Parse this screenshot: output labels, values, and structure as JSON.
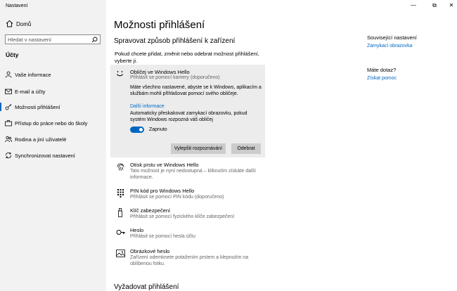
{
  "window": {
    "title": "Nastavení",
    "minimize": "—",
    "maximize": "⧉",
    "close": "✕"
  },
  "sidebar": {
    "home_label": "Domů",
    "search_placeholder": "Hledat v nastavení",
    "section": "Účty",
    "items": [
      {
        "label": "Vaše informace",
        "icon": "person-card-icon"
      },
      {
        "label": "E-mail a účty",
        "icon": "mail-icon"
      },
      {
        "label": "Možnosti přihlášení",
        "icon": "key-icon",
        "active": true
      },
      {
        "label": "Přístup do práce nebo do školy",
        "icon": "briefcase-icon"
      },
      {
        "label": "Rodina a jiní uživatelé",
        "icon": "people-icon"
      },
      {
        "label": "Synchronizovat nastavení",
        "icon": "sync-icon"
      }
    ]
  },
  "main": {
    "title": "Možnosti přihlášení",
    "subtitle": "Spravovat způsob přihlášení k zařízení",
    "intro": "Pokud chcete přidat, změnit nebo odebrat možnost přihlášení, vyberte ji.",
    "hello_face": {
      "title": "Obličej ve Windows Hello",
      "subtitle": "Přihlásit se pomocí kamery (doporučeno)",
      "description": "Máte všechno nastavené, abyste se k Windows, aplikacím a službám mohli přihlašovat pomocí svého obličeje.",
      "more_link": "Další informace",
      "auto_text": "Automaticky přeskakovat zamykací obrazovku, pokud systém Windows rozpozná váš obličej",
      "toggle_label": "Zapnuto",
      "toggle_on": true,
      "improve_button": "Vylepšit rozpoznávání",
      "remove_button": "Odebrat"
    },
    "options": [
      {
        "title": "Otisk prstu ve Windows Hello",
        "subtitle": "Tato možnost je nyní nedostupná – kliknutím získáte další informace.",
        "icon": "fingerprint-icon"
      },
      {
        "title": "PIN kód pro Windows Hello",
        "subtitle": "Přihlásit se pomocí PIN kódu (doporučeno)",
        "icon": "pin-keypad-icon"
      },
      {
        "title": "Klíč zabezpečení",
        "subtitle": "Přihlásit se pomocí fyzického klíče zabezpečení",
        "icon": "usb-key-icon"
      },
      {
        "title": "Heslo",
        "subtitle": "Přihlásit se pomocí hesla účtu",
        "icon": "password-key-icon"
      },
      {
        "title": "Obrázkové heslo",
        "subtitle": "Zařízení odemknete potažením prstem a klepnutím na oblíbenou fotku.",
        "icon": "picture-icon"
      }
    ],
    "require_title": "Vyžadovat přihlášení"
  },
  "right": {
    "related_title": "Související nastavení",
    "related_link": "Zamykací obrazovka",
    "question_title": "Máte dotaz?",
    "help_link": "Získat pomoc"
  },
  "colors": {
    "accent": "#0067c0",
    "sidebar_bg": "#f2f2f2",
    "card_bg": "#ececec"
  }
}
